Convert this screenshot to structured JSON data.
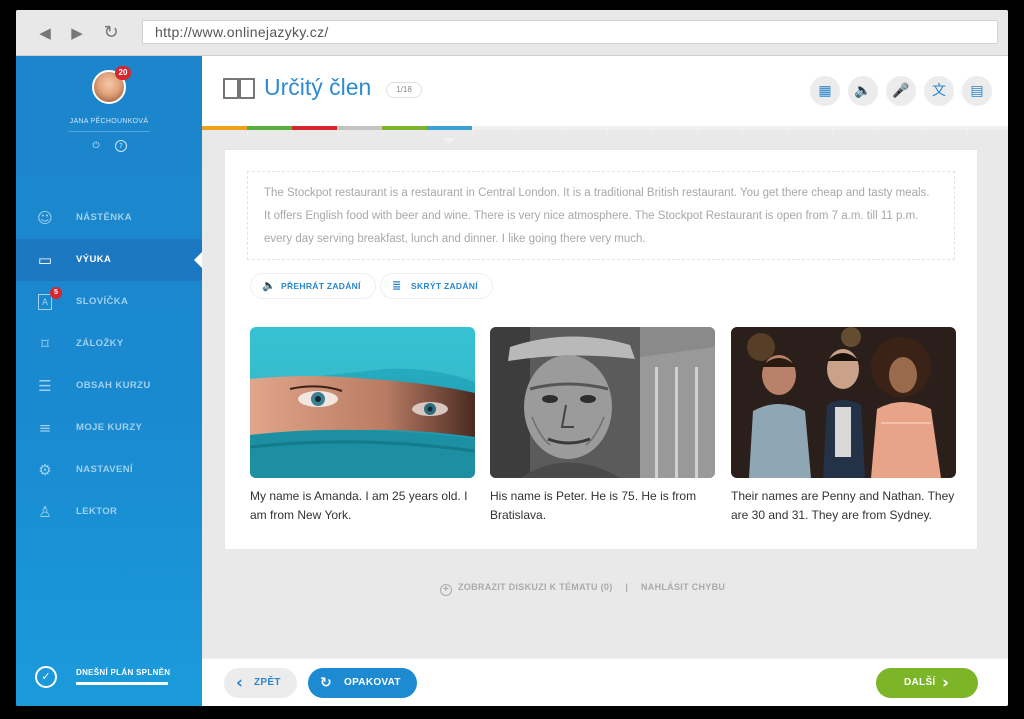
{
  "browser": {
    "url": "http://www.onlinejazyky.cz/",
    "back_glyph": "◀",
    "forward_glyph": "▶",
    "reload_glyph": "↻"
  },
  "user": {
    "name": "JANA PĚCHOUNKOVÁ",
    "notification_count": "20",
    "logout_glyph": "⏻",
    "help_glyph": "?"
  },
  "sidebar": {
    "items": [
      {
        "label": "NÁSTĚNKA",
        "icon": "dashboard-icon",
        "glyph": "☺"
      },
      {
        "label": "VÝUKA",
        "icon": "book-icon",
        "glyph": "▭",
        "active": true
      },
      {
        "label": "SLOVÍČKA",
        "icon": "vocabulary-icon",
        "glyph": "A",
        "badge": "5"
      },
      {
        "label": "ZÁLOŽKY",
        "icon": "bookmark-icon",
        "glyph": "⌑"
      },
      {
        "label": "OBSAH KURZU",
        "icon": "course-content-icon",
        "glyph": "☰"
      },
      {
        "label": "MOJE KURZY",
        "icon": "my-courses-icon",
        "glyph": "≡"
      },
      {
        "label": "NASTAVENÍ",
        "icon": "gear-icon",
        "glyph": "⚙"
      },
      {
        "label": "LEKTOR",
        "icon": "tutor-icon",
        "glyph": "♙"
      }
    ],
    "plan_label": "DNEŠNÍ PLÁN SPLNĚN",
    "plan_glyph": "✓"
  },
  "header": {
    "title": "Určitý člen",
    "counter": "1/18",
    "tools": [
      {
        "name": "keyboard-icon",
        "glyph": "▦"
      },
      {
        "name": "speaker-icon",
        "glyph": "🔈"
      },
      {
        "name": "microphone-icon",
        "glyph": "🎤"
      },
      {
        "name": "translate-icon",
        "glyph": "文"
      },
      {
        "name": "notes-icon",
        "glyph": "▤"
      }
    ]
  },
  "progress": {
    "colors": [
      "#f0a11b",
      "#5aae3c",
      "#d8262e",
      "#c3c3c3",
      "#7db528",
      "#3aa0d8"
    ],
    "accent": "#2e8bd0"
  },
  "exercise": {
    "intro": "The Stockpot restaurant is a restaurant in Central London. It is a traditional British restaurant. You get there cheap and tasty meals. It offers English food with beer and wine. There is very nice atmosphere. The Stockpot Restaurant is open from 7 a.m. till 11 p.m. every day serving breakfast, lunch and dinner. I like going there very much.",
    "play_label": "PŘEHRÁT ZADÁNÍ",
    "play_glyph": "🔈",
    "hide_label": "SKRÝT ZADÁNÍ",
    "hide_glyph": "≣",
    "cards": [
      {
        "caption": "My name is Amanda. I am 25 years old. I am from New York."
      },
      {
        "caption": "His name is Peter. He is 75. He is from Bratislava."
      },
      {
        "caption": "Their names are Penny and Nathan. They are 30 and 31. They are from Sydney."
      }
    ]
  },
  "footer": {
    "discussion_label": "ZOBRAZIT DISKUZI K TÉMATU (0)",
    "separator": "|",
    "report_label": "NAHLÁSIT CHYBU"
  },
  "actions": {
    "back_label": "ZPĚT",
    "back_glyph": "‹",
    "repeat_label": "OPAKOVAT",
    "repeat_glyph": "↻",
    "next_label": "DALŠÍ",
    "next_glyph": "›"
  }
}
